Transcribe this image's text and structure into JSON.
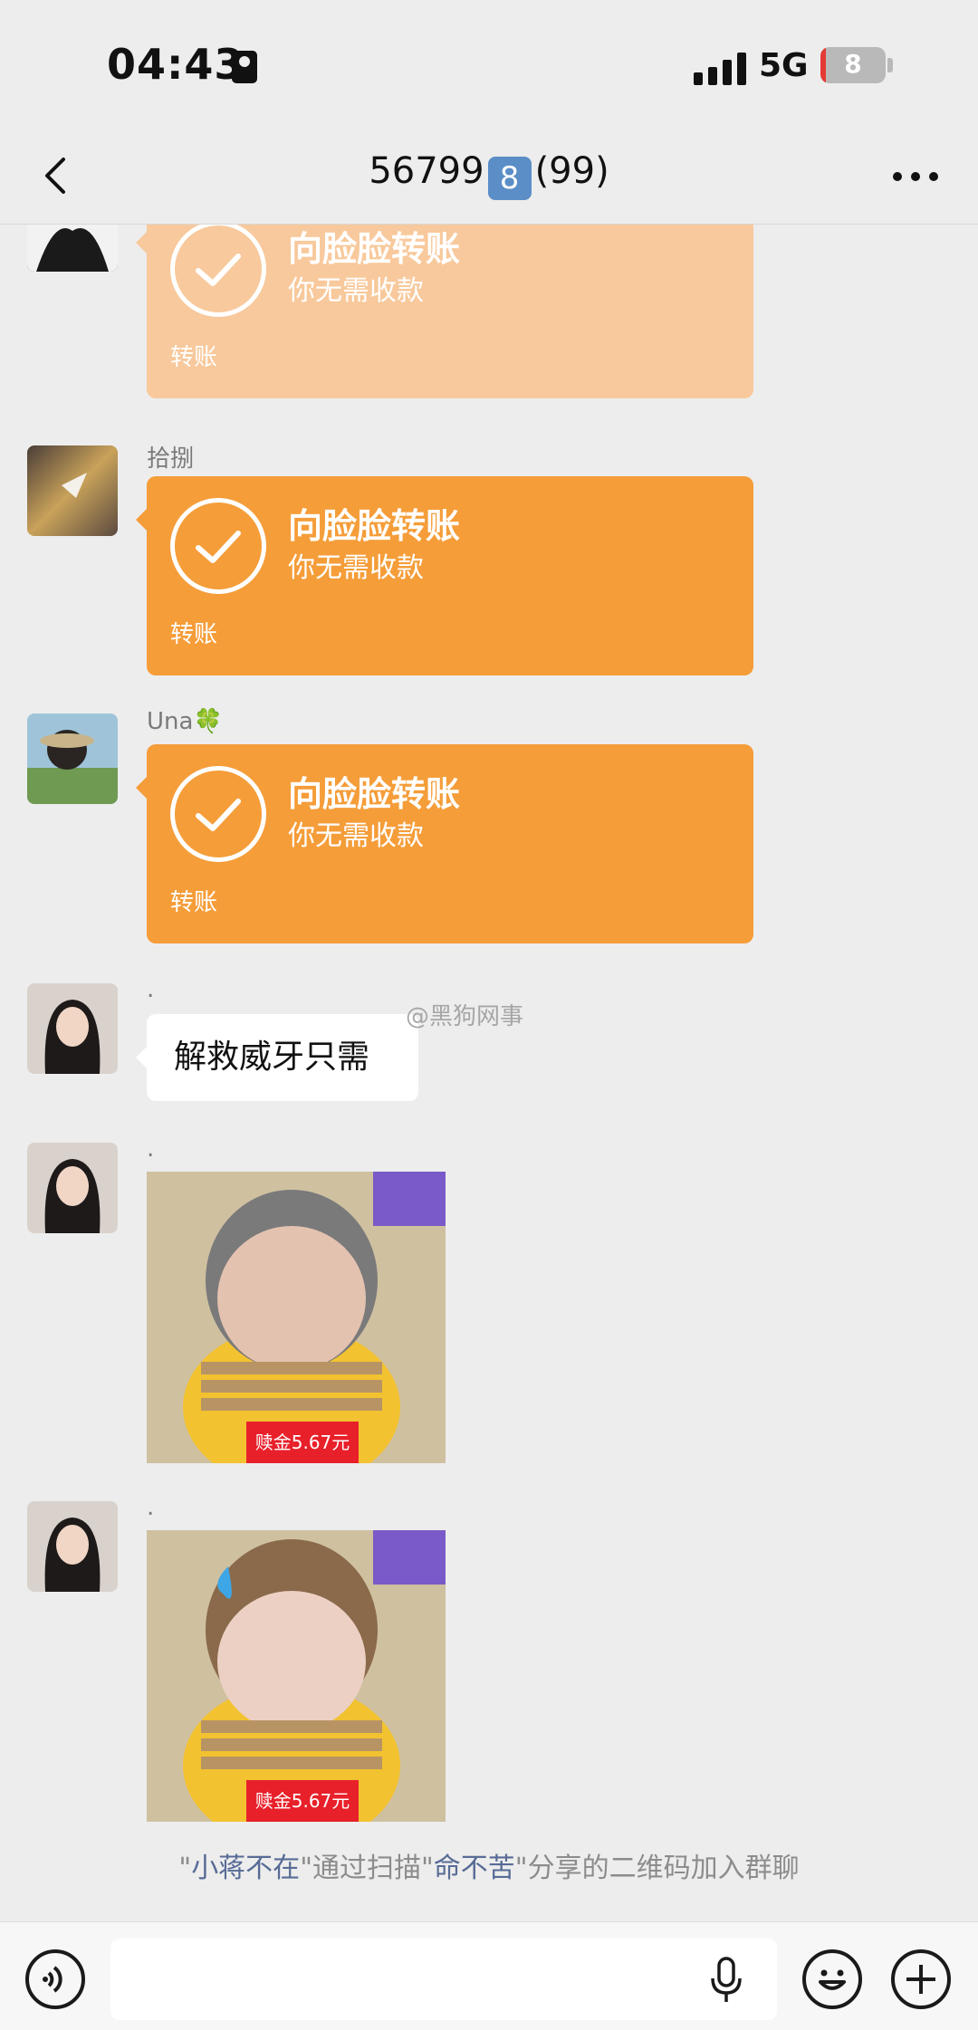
{
  "status_bar": {
    "time": "04:43",
    "network": "5G",
    "battery": "8",
    "battery_level_pct": 8,
    "icons": [
      "contact-card-icon",
      "signal-icon",
      "battery-icon",
      "charging-icon"
    ]
  },
  "nav": {
    "title_prefix": "56799",
    "title_badge": "8",
    "title_suffix": "(99)",
    "icons": [
      "back-icon",
      "more-icon"
    ]
  },
  "messages": [
    {
      "type": "transfer",
      "sender": "",
      "title": "向脸脸转账",
      "subtitle": "你无需收款",
      "label": "转账",
      "faded": true
    },
    {
      "type": "transfer",
      "sender": "拾捌",
      "title": "向脸脸转账",
      "subtitle": "你无需收款",
      "label": "转账"
    },
    {
      "type": "transfer",
      "sender": "Una🍀",
      "title": "向脸脸转账",
      "subtitle": "你无需收款",
      "label": "转账"
    },
    {
      "type": "text",
      "sender": ".",
      "text": "解救威牙只需"
    },
    {
      "type": "sticker",
      "sender": ".",
      "caption": "赎金5.67元"
    },
    {
      "type": "sticker",
      "sender": ".",
      "caption": "赎金5.67元"
    }
  ],
  "system_message": {
    "q1": "\"",
    "user1": "小蒋不在",
    "mid": "\"通过扫描\"",
    "user2": "命不苦",
    "end": "\"分享的二维码加入群聊"
  },
  "watermark": "@黑狗网事",
  "input": {
    "placeholder": "",
    "icons": [
      "voice-icon",
      "mic-icon",
      "emoji-icon",
      "plus-icon"
    ]
  },
  "colors": {
    "background": "#ededed",
    "transfer_orange": "#f59d39",
    "transfer_faded": "#f8c99c",
    "link_blue": "#576b95",
    "ransom_red": "#e8202a"
  }
}
